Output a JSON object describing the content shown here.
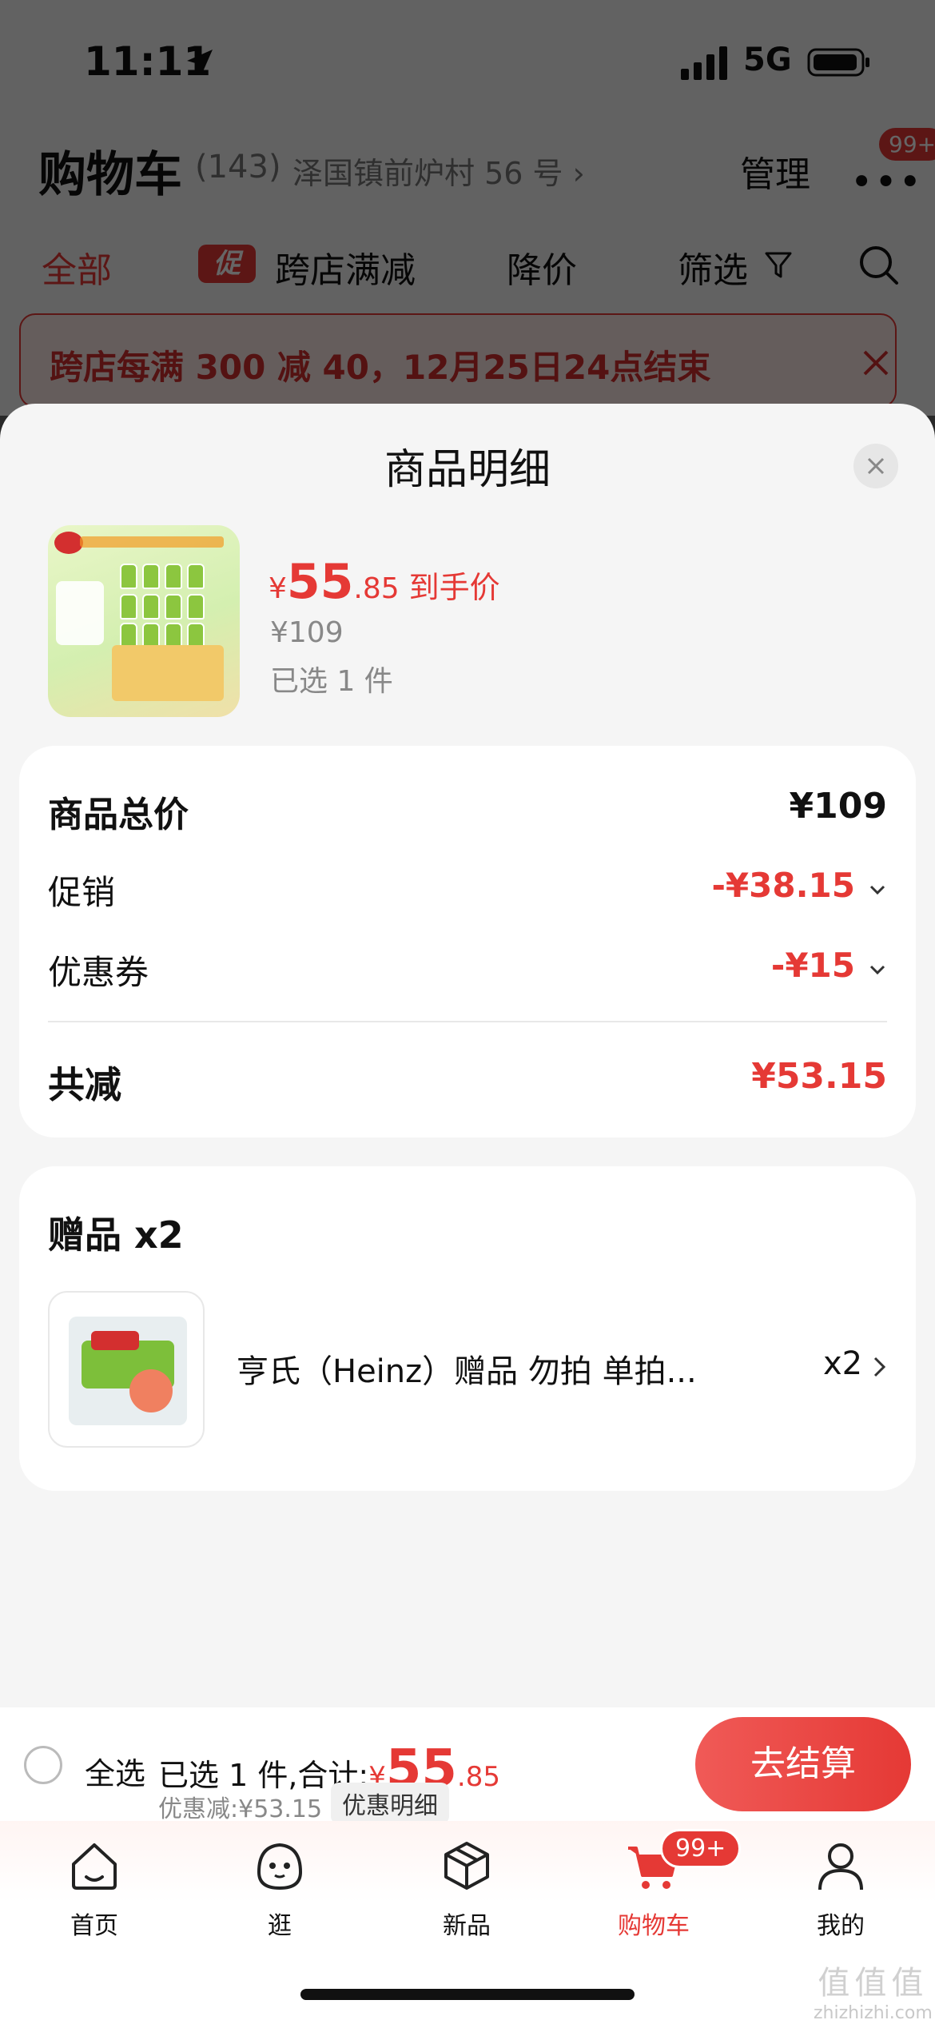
{
  "status_bar": {
    "time": "11:11",
    "network": "5G"
  },
  "cart_header": {
    "title": "购物车",
    "count": "(143)",
    "address": "泽国镇前炉村 56 号 ›",
    "manage": "管理",
    "more_badge": "99+"
  },
  "filters": {
    "all": "全部",
    "promo_tag": "促",
    "promo": "跨店满减",
    "price_drop": "降价",
    "filter": "筛选"
  },
  "promo_banner": {
    "text": "跨店每满 300 减 40，12月25日24点结束"
  },
  "sheet": {
    "title": "商品明细",
    "product": {
      "price_symbol": "¥",
      "price_int": "55",
      "price_dec": ".85",
      "price_label": "到手价",
      "original_price": "¥109",
      "selected": "已选 1 件"
    },
    "summary": {
      "total_label": "商品总价",
      "total_value": "¥109",
      "promo_label": "促销",
      "promo_value": "-¥38.15",
      "coupon_label": "优惠券",
      "coupon_value": "-¥15",
      "saved_label": "共减",
      "saved_value": "¥53.15"
    },
    "gift": {
      "title": "赠品 x2",
      "name": "亨氏（Heinz）赠品 勿拍  单拍...",
      "qty": "x2"
    }
  },
  "checkout": {
    "select_all": "全选",
    "selected_prefix": "已选 1 件,合计:",
    "total_symbol": "¥",
    "total_int": "55",
    "total_dec": ".85",
    "discount": "优惠减:¥53.15",
    "discount_detail": "优惠明细",
    "button": "去结算"
  },
  "tabbar": {
    "tabs": [
      {
        "label": "首页",
        "icon": "home-icon"
      },
      {
        "label": "逛",
        "icon": "browse-face-icon"
      },
      {
        "label": "新品",
        "icon": "new-box-icon"
      },
      {
        "label": "购物车",
        "icon": "cart-icon"
      },
      {
        "label": "我的",
        "icon": "profile-icon"
      }
    ],
    "cart_badge": "99+",
    "active_color": "#e53935"
  },
  "watermark": {
    "top": "值值值",
    "bottom": "zhizhizhi.com"
  },
  "colors": {
    "accent": "#e53935",
    "background": "#f5f5f5"
  }
}
